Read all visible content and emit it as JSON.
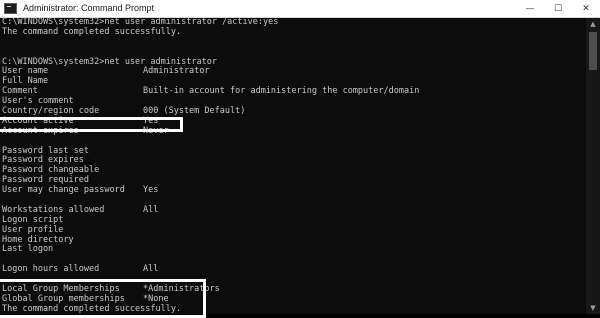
{
  "window": {
    "title": "Administrator: Command Prompt",
    "icon": "cmd-icon",
    "controls": {
      "minimize": "—",
      "maximize": "☐",
      "close": "✕"
    }
  },
  "console": {
    "lines": [
      {
        "text": "C:\\WINDOWS\\system32>net user administrator /active:yes"
      },
      {
        "text": "The command completed successfully."
      },
      {
        "text": ""
      },
      {
        "text": ""
      },
      {
        "text": "C:\\WINDOWS\\system32>net user administrator"
      },
      {
        "key": "User name",
        "value": "Administrator"
      },
      {
        "key": "Full Name",
        "value": ""
      },
      {
        "key": "Comment",
        "value": "Built-in account for administering the computer/domain"
      },
      {
        "key": "User's comment",
        "value": ""
      },
      {
        "key": "Country/region code",
        "value": "000 (System Default)"
      },
      {
        "key": "Account active",
        "value": "Yes"
      },
      {
        "key": "Account expires",
        "value": "Never"
      },
      {
        "text": ""
      },
      {
        "key": "Password last set",
        "value": ""
      },
      {
        "key": "Password expires",
        "value": ""
      },
      {
        "key": "Password changeable",
        "value": ""
      },
      {
        "key": "Password required",
        "value": ""
      },
      {
        "key": "User may change password",
        "value": "Yes"
      },
      {
        "text": ""
      },
      {
        "key": "Workstations allowed",
        "value": "All"
      },
      {
        "key": "Logon script",
        "value": ""
      },
      {
        "key": "User profile",
        "value": ""
      },
      {
        "key": "Home directory",
        "value": ""
      },
      {
        "key": "Last logon",
        "value": ""
      },
      {
        "text": ""
      },
      {
        "key": "Logon hours allowed",
        "value": "All"
      },
      {
        "text": ""
      },
      {
        "key": "Local Group Memberships",
        "value": "*Administrators"
      },
      {
        "key": "Global Group memberships",
        "value": "*None"
      },
      {
        "text": "The command completed successfully."
      }
    ]
  },
  "scrollbar": {
    "up": "▲",
    "down": "▼"
  }
}
